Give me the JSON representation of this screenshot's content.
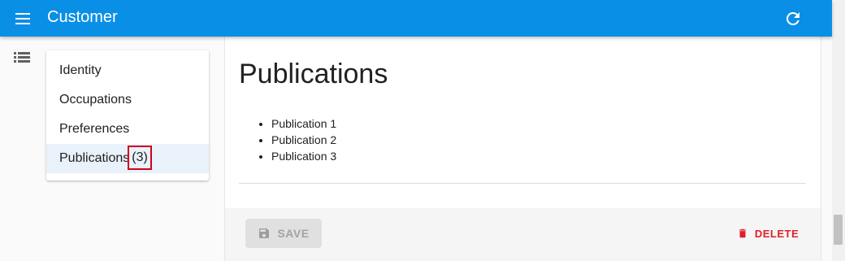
{
  "app": {
    "title": "Customer"
  },
  "sidebar": {
    "items": [
      {
        "label": "Identity"
      },
      {
        "label": "Occupations"
      },
      {
        "label": "Preferences"
      },
      {
        "label": "Publications",
        "count": "(3)"
      }
    ]
  },
  "main": {
    "title": "Publications",
    "publications": [
      "Publication 1",
      "Publication 2",
      "Publication 3"
    ]
  },
  "toolbar": {
    "save_label": "SAVE",
    "delete_label": "DELETE"
  },
  "colors": {
    "appbar": "#0a8fe6",
    "delete": "#e02028",
    "badge_border": "#d0021b"
  }
}
